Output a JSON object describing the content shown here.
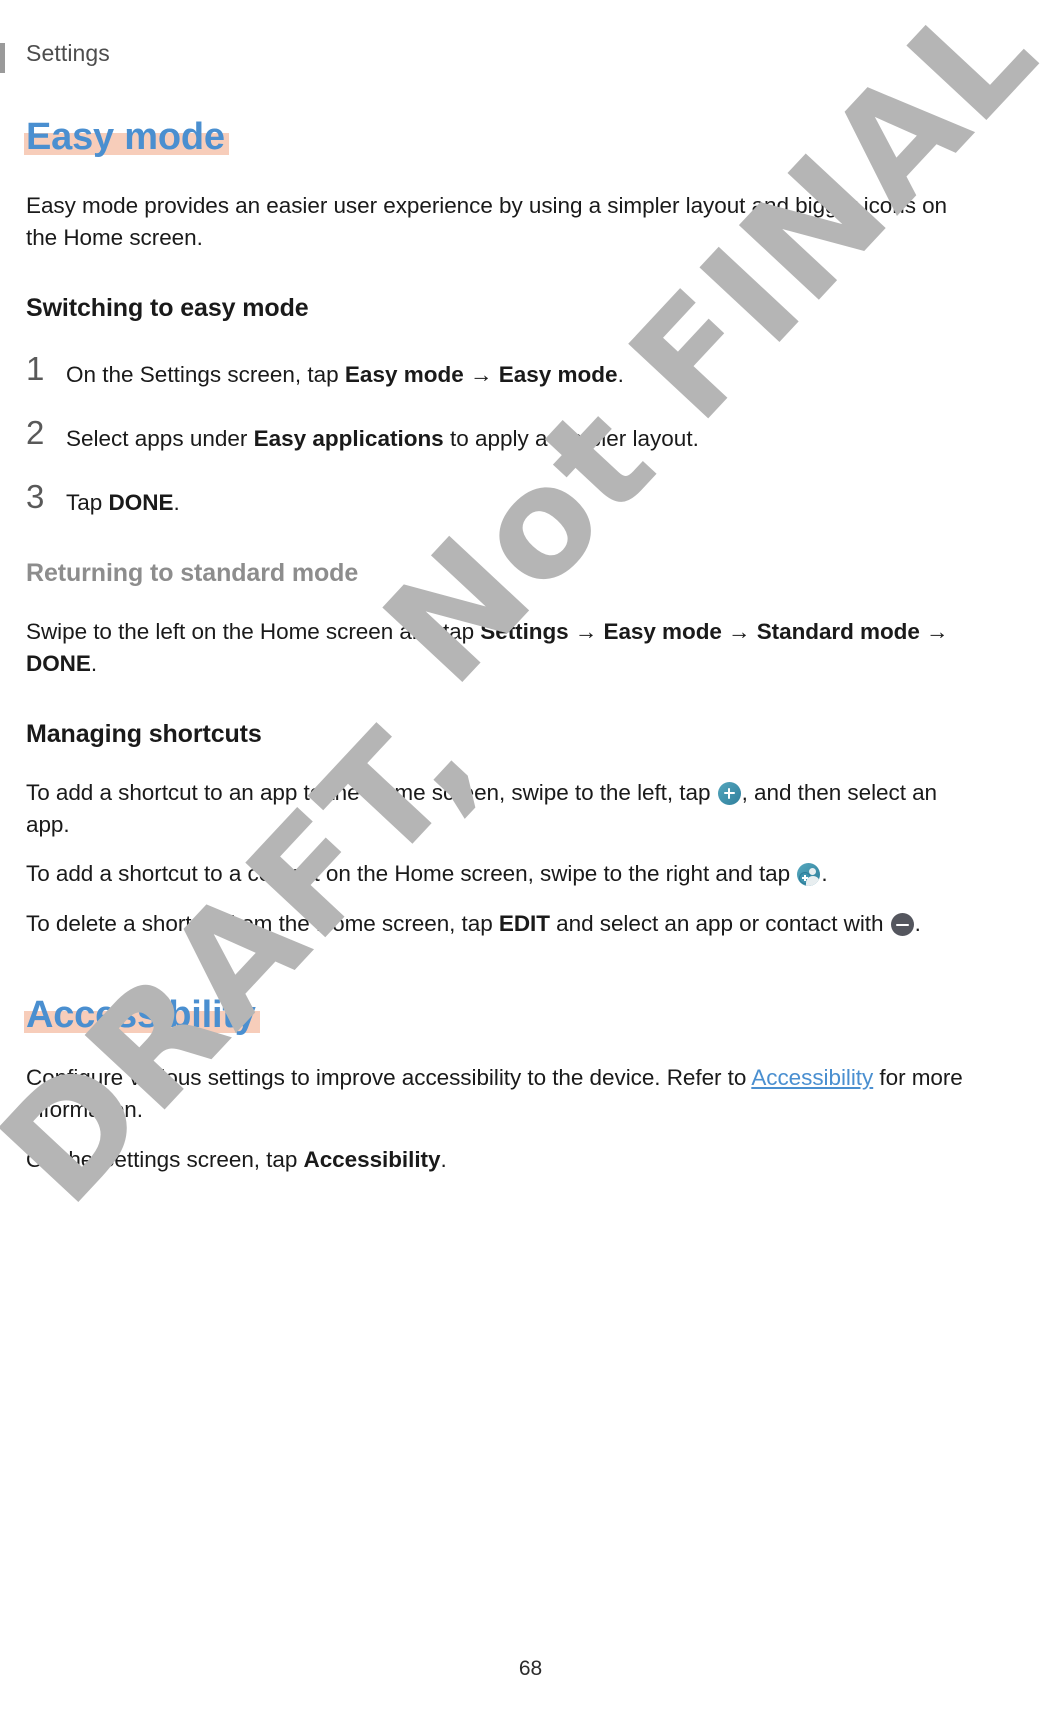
{
  "header": {
    "title": "Settings"
  },
  "sections": [
    {
      "heading": "Easy mode",
      "intro": "Easy mode provides an easier user experience by using a simpler layout and bigger icons on the Home screen.",
      "sub1": {
        "heading": "Switching to easy mode",
        "steps": [
          {
            "num": "1",
            "pre": "On the Settings screen, tap ",
            "b1": "Easy mode",
            "arrow": " → ",
            "b2": "Easy mode",
            "post": "."
          },
          {
            "num": "2",
            "pre": "Select apps under ",
            "b1": "Easy applications",
            "post": " to apply a simpler layout."
          },
          {
            "num": "3",
            "pre": "Tap ",
            "b1": "DONE",
            "post": "."
          }
        ]
      },
      "sub2": {
        "heading": "Returning to standard mode",
        "body_pre": "Swipe to the left on the Home screen and tap ",
        "b1": "Settings",
        "arrow1": " → ",
        "b2": "Easy mode",
        "arrow2": " → ",
        "b3": "Standard mode",
        "arrow3": " → ",
        "b4": "DONE",
        "body_post": "."
      },
      "sub3": {
        "heading": "Managing shortcuts",
        "para1_pre": "To add a shortcut to an app to the Home screen, swipe to the left, tap ",
        "para1_icon": "add-plus-icon",
        "para1_post": ", and then select an app.",
        "para2_pre": "To add a shortcut to a contact on the Home screen, swipe to the right and tap ",
        "para2_icon": "add-contact-icon",
        "para2_post": ".",
        "para3_pre": "To delete a shortcut from the Home screen, tap ",
        "para3_b": "EDIT",
        "para3_mid": " and select an app or contact with ",
        "para3_icon": "remove-minus-icon",
        "para3_post": "."
      }
    },
    {
      "heading": "Accessibility",
      "body_pre": "Configure various settings to improve accessibility to the device. Refer to ",
      "body_link": "Accessibility",
      "body_post": " for more information.",
      "body2_pre": "On the Settings screen, tap ",
      "body2_b": "Accessibility",
      "body2_post": "."
    }
  ],
  "watermark": {
    "line1": "Not FINAL",
    "line2": "DRAFT,"
  },
  "footer": {
    "page_number": "68"
  },
  "colors": {
    "heading_blue": "#4a8fd0",
    "highlight_peach": "#f7cdba",
    "muted_gray": "#8d8d8d",
    "icon_teal": "#2f7f9c",
    "icon_dark": "#54565e",
    "watermark_gray": "#b5b5b5"
  }
}
